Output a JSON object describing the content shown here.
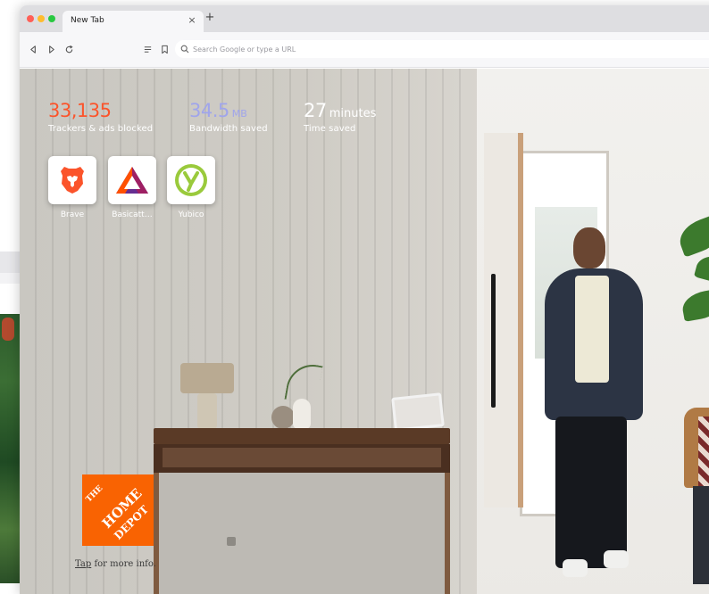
{
  "browser": {
    "tab_title": "New Tab",
    "tab_close_glyph": "×",
    "new_tab_glyph": "+",
    "url_placeholder": "Search Google or type a URL",
    "icons": [
      "back-icon",
      "forward-icon",
      "reload-icon",
      "reader-icon",
      "bookmark-icon",
      "search-icon"
    ]
  },
  "stats": {
    "trackers": {
      "value": "33,135",
      "label": "Trackers & ads blocked",
      "color": "#fb542b"
    },
    "bandwidth": {
      "value": "34.5",
      "unit": "MB",
      "label": "Bandwidth saved",
      "color": "#a0a5eb"
    },
    "time": {
      "value": "27",
      "unit": "minutes",
      "label": "Time saved",
      "color": "#ffffff"
    }
  },
  "top_sites": [
    {
      "name": "Brave",
      "icon": "brave-lion-icon",
      "color": "#fb542b"
    },
    {
      "name": "Basicatt…",
      "icon": "bat-triangle-icon",
      "color": "#662d91"
    },
    {
      "name": "Yubico",
      "icon": "yubico-icon",
      "color": "#9aca3c"
    }
  ],
  "sponsored": {
    "logo_lines": [
      "THE",
      "HOME",
      "DEPOT"
    ],
    "logo_color": "#f96302",
    "cta_link": "Tap",
    "cta_rest": " for more info."
  }
}
